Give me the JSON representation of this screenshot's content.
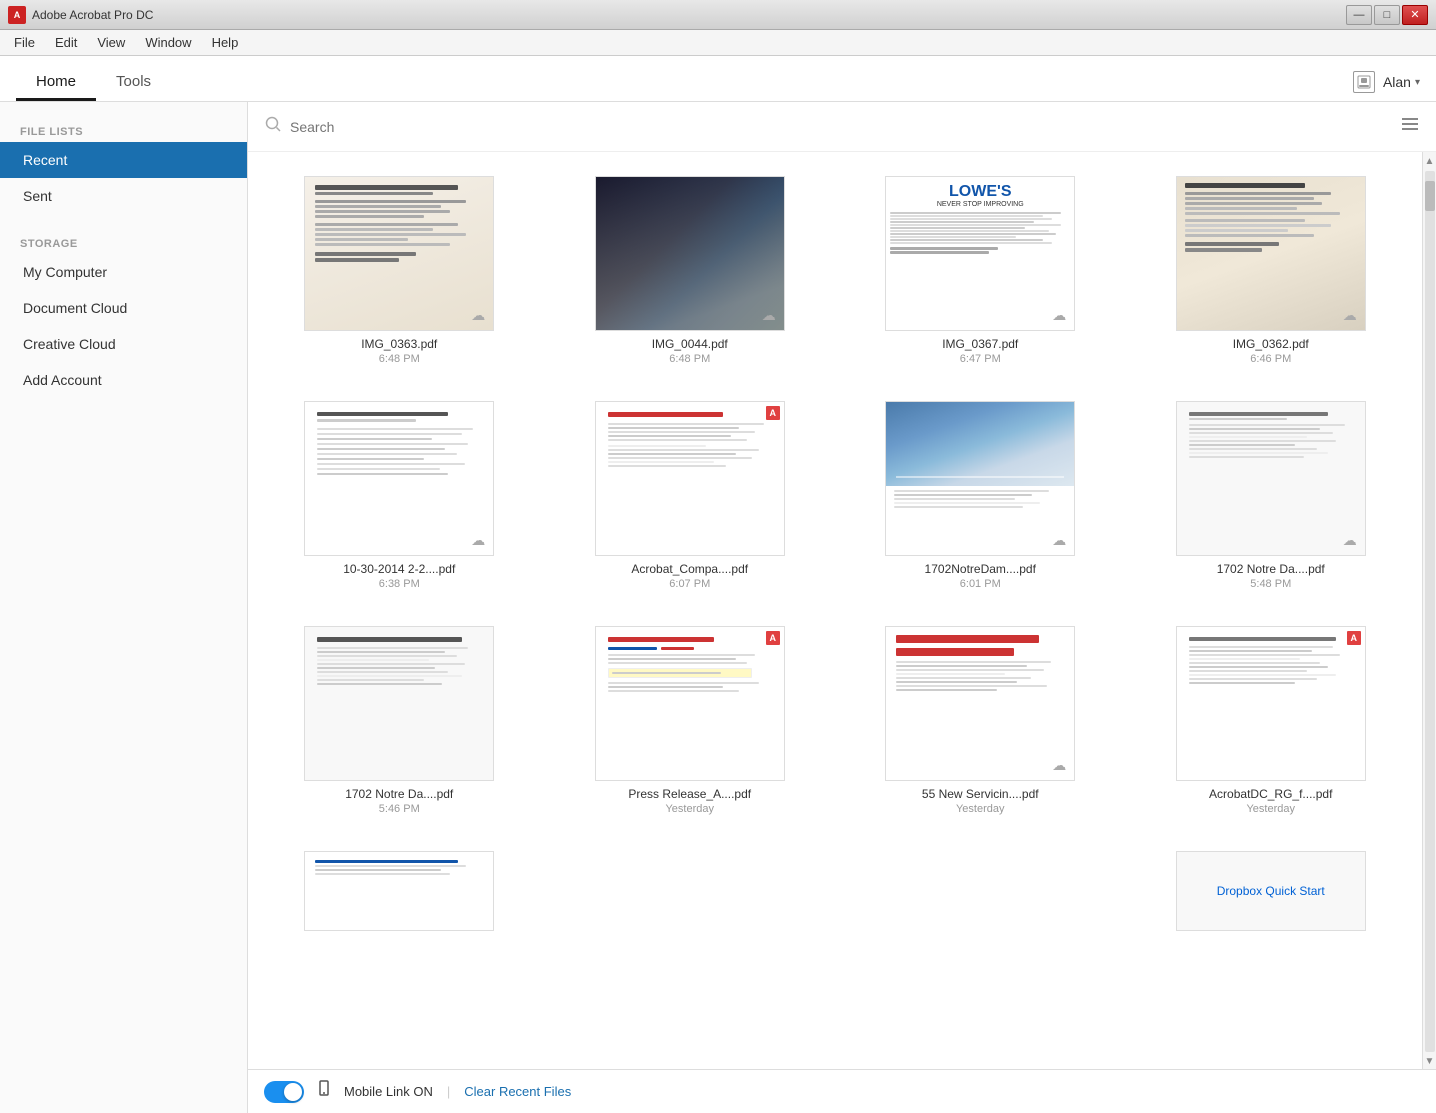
{
  "titleBar": {
    "appName": "Adobe Acrobat Pro DC",
    "controls": [
      "minimize",
      "restore",
      "close"
    ]
  },
  "menuBar": {
    "items": [
      "File",
      "Edit",
      "View",
      "Window",
      "Help"
    ]
  },
  "tabs": {
    "items": [
      "Home",
      "Tools"
    ],
    "active": "Home"
  },
  "userArea": {
    "name": "Alan",
    "dropdownIcon": "chevron-down"
  },
  "sidebar": {
    "sections": [
      {
        "label": "FILE LISTS",
        "items": [
          {
            "id": "recent",
            "label": "Recent",
            "active": true
          },
          {
            "id": "sent",
            "label": "Sent",
            "active": false
          }
        ]
      },
      {
        "label": "STORAGE",
        "items": [
          {
            "id": "my-computer",
            "label": "My Computer",
            "active": false
          },
          {
            "id": "document-cloud",
            "label": "Document Cloud",
            "active": false
          },
          {
            "id": "creative-cloud",
            "label": "Creative Cloud",
            "active": false
          },
          {
            "id": "add-account",
            "label": "Add Account",
            "active": false
          }
        ]
      }
    ]
  },
  "searchBar": {
    "placeholder": "Search"
  },
  "files": [
    {
      "id": "f1",
      "name": "IMG_0363.pdf",
      "time": "6:48 PM",
      "type": "receipt-dark",
      "hasCloud": true
    },
    {
      "id": "f2",
      "name": "IMG_0044.pdf",
      "time": "6:48 PM",
      "type": "photo-dark",
      "hasCloud": true
    },
    {
      "id": "f3",
      "name": "IMG_0367.pdf",
      "time": "6:47 PM",
      "type": "lowes",
      "hasCloud": true
    },
    {
      "id": "f4",
      "name": "IMG_0362.pdf",
      "time": "6:46 PM",
      "type": "receipt-light",
      "hasCloud": true
    },
    {
      "id": "f5",
      "name": "10-30-2014 2-2....pdf",
      "time": "6:38 PM",
      "type": "document",
      "hasCloud": true,
      "hasAcrobat": false
    },
    {
      "id": "f6",
      "name": "Acrobat_Compa....pdf",
      "time": "6:07 PM",
      "type": "acrobat-doc",
      "hasCloud": false,
      "hasAcrobat": true
    },
    {
      "id": "f7",
      "name": "1702NotreDam....pdf",
      "time": "6:01 PM",
      "type": "notre-dame",
      "hasCloud": true,
      "hasAcrobat": false
    },
    {
      "id": "f8",
      "name": "1702 Notre Da....pdf",
      "time": "5:48 PM",
      "type": "text-doc",
      "hasCloud": true,
      "hasAcrobat": false
    },
    {
      "id": "f9",
      "name": "1702 Notre Da....pdf",
      "time": "5:46 PM",
      "type": "text-doc2",
      "hasCloud": false,
      "hasAcrobat": false
    },
    {
      "id": "f10",
      "name": "Press Release_A....pdf",
      "time": "Yesterday",
      "type": "press-release",
      "hasCloud": false,
      "hasAcrobat": true
    },
    {
      "id": "f11",
      "name": "55 New Servicin....pdf",
      "time": "Yesterday",
      "type": "service-doc",
      "hasCloud": true,
      "hasAcrobat": false
    },
    {
      "id": "f12",
      "name": "AcrobatDC_RG_f....pdf",
      "time": "Yesterday",
      "type": "acrobat-rg",
      "hasCloud": false,
      "hasAcrobat": true
    }
  ],
  "bottomRow": {
    "files": [
      {
        "id": "f13",
        "name": "...",
        "time": "",
        "type": "doc-partial"
      },
      {
        "id": "f14",
        "name": "Dropbox Quick Start",
        "time": "",
        "type": "dropbox"
      }
    ]
  },
  "bottomBar": {
    "mobileLinkLabel": "Mobile Link ON",
    "clearLabel": "Clear Recent Files",
    "separator": "|"
  }
}
